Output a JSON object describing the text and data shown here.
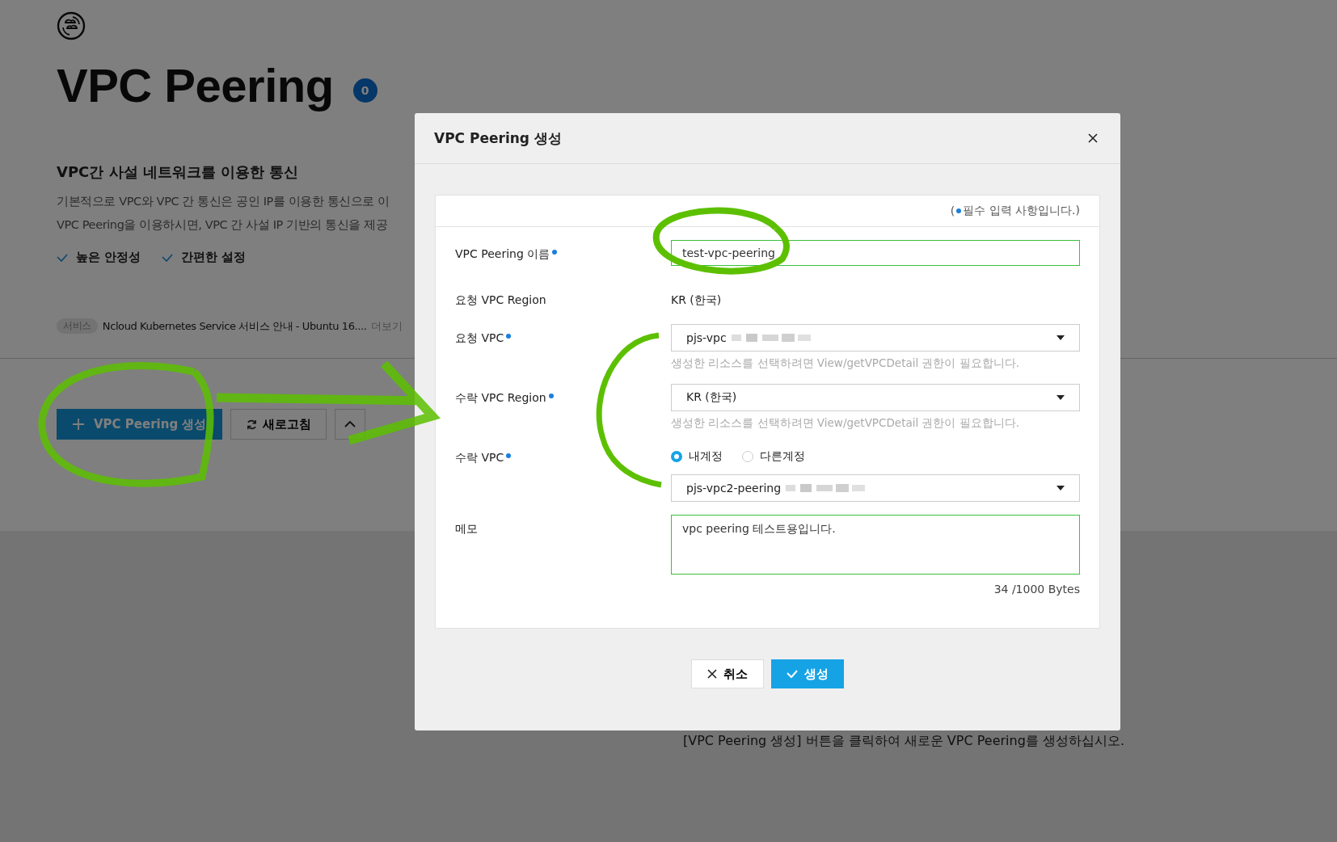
{
  "page": {
    "title": "VPC Peering",
    "count": "0",
    "subtitle": "VPC간 사설 네트워크를 이용한 통신",
    "description": [
      "기본적으로 VPC와 VPC 간 통신은 공인 IP를 이용한 통신으로 이",
      "VPC Peering을 이용하시면, VPC 간 사설 IP 기반의 통신을 제공"
    ],
    "features": [
      "높은 안정성",
      "간편한 설정"
    ],
    "notice": {
      "tag": "서비스",
      "text": "Ncloud Kubernetes Service 서비스 안내 - Ubuntu 16....",
      "more": "더보기"
    },
    "toolbar": {
      "create_button": "VPC Peering 생성",
      "refresh_button": "새로고침"
    },
    "empty_message": "[VPC Peering 생성] 버튼을 클릭하여 새로운 VPC Peering를 생성하십시오."
  },
  "dialog": {
    "title": "VPC Peering 생성",
    "required_note_open": "(",
    "required_note": "필수 입력 사항입니다.)",
    "fields": [
      {
        "kind": "text_input",
        "label": "VPC Peering 이름",
        "required": true,
        "value": "test-vpc-peering"
      },
      {
        "kind": "static",
        "label": "요청 VPC Region",
        "required": false,
        "value": "KR (한국)"
      },
      {
        "kind": "select",
        "label": "요청 VPC",
        "required": true,
        "value": "pjs-vpc",
        "redacted": true,
        "hint": "생성한 리소스를 선택하려면 View/getVPCDetail 권한이 필요합니다."
      },
      {
        "kind": "select",
        "label": "수락 VPC Region",
        "required": true,
        "value": "KR (한국)",
        "redacted": false,
        "hint": "생성한 리소스를 선택하려면 View/getVPCDetail 권한이 필요합니다."
      },
      {
        "kind": "radio_select",
        "label": "수락 VPC",
        "required": true,
        "options": [
          {
            "label": "내계정",
            "selected": true
          },
          {
            "label": "다른계정",
            "selected": false
          }
        ],
        "value": "pjs-vpc2-peering",
        "redacted": true
      },
      {
        "kind": "textarea",
        "label": "메모",
        "required": false,
        "value": "vpc peering 테스트용입니다.",
        "counter": "34 /1000 Bytes"
      }
    ],
    "buttons": {
      "cancel": "취소",
      "submit": "생성"
    }
  }
}
